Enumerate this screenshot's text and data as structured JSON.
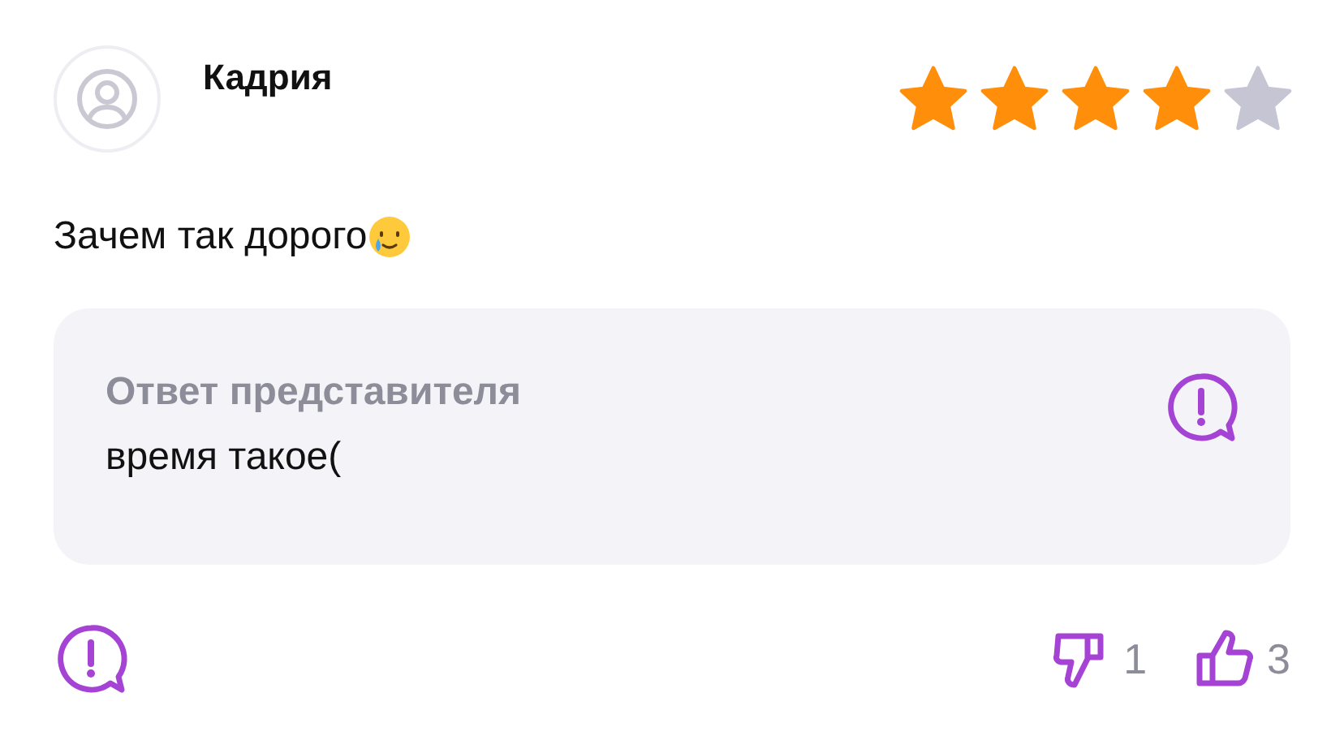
{
  "review": {
    "author": "Кадрия",
    "stars": 4,
    "text": "Зачем так дорого"
  },
  "reply": {
    "title": "Ответ представителя",
    "text": "время такое("
  },
  "reactions": {
    "dislikes": "1",
    "likes": "3"
  }
}
